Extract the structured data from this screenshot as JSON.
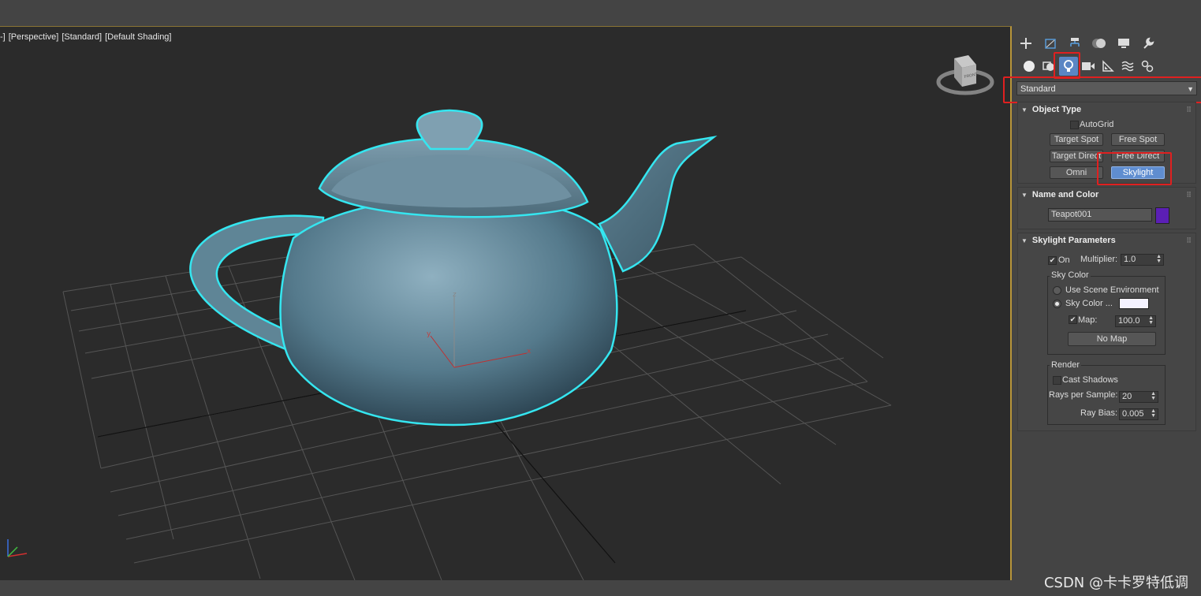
{
  "viewport": {
    "labels": [
      "-]",
      "[Perspective]",
      "[Standard]",
      "[Default Shading]"
    ],
    "axis": {
      "x": "x",
      "y": "y",
      "z": "z"
    },
    "viewcube_label": "FRONT"
  },
  "panel": {
    "top_tabs": [
      "create-icon",
      "modify-icon",
      "hierarchy-icon",
      "motion-icon",
      "display-icon",
      "utilities-icon"
    ],
    "category_tabs": [
      "geometry-icon",
      "shapes-icon",
      "lights-icon",
      "cameras-icon",
      "helpers-icon",
      "spacewarps-icon",
      "systems-icon"
    ],
    "dropdown": {
      "value": "Standard"
    },
    "object_type": {
      "title": "Object Type",
      "autogrid": "AutoGrid",
      "buttons": [
        "Target Spot",
        "Free Spot",
        "Target Direct",
        "Free Direct",
        "Omni",
        "Skylight"
      ],
      "selected": "Skylight"
    },
    "name_color": {
      "title": "Name and Color",
      "name": "Teapot001",
      "color": "#5b1fb5"
    },
    "skylight": {
      "title": "Skylight Parameters",
      "on_label": "On",
      "on_checked": true,
      "multiplier_label": "Multiplier:",
      "multiplier": "1.0",
      "sky_color_group": "Sky Color",
      "use_scene_env": "Use Scene Environment",
      "sky_color_label": "Sky Color ...",
      "sky_color_swatch": "#f4f2ff",
      "map_label": "Map:",
      "map_checked": true,
      "map_value": "100.0",
      "no_map": "No Map",
      "render_group": "Render",
      "cast_shadows": "Cast Shadows",
      "rays_label": "Rays per Sample:",
      "rays": "20",
      "ray_bias_label": "Ray Bias:",
      "ray_bias": "0.005"
    }
  },
  "watermark": "CSDN @卡卡罗特低调",
  "colors": {
    "selection_outline": "#35e6f0",
    "highlight_box": "#e02020",
    "active_tab": "#5b86c4"
  }
}
